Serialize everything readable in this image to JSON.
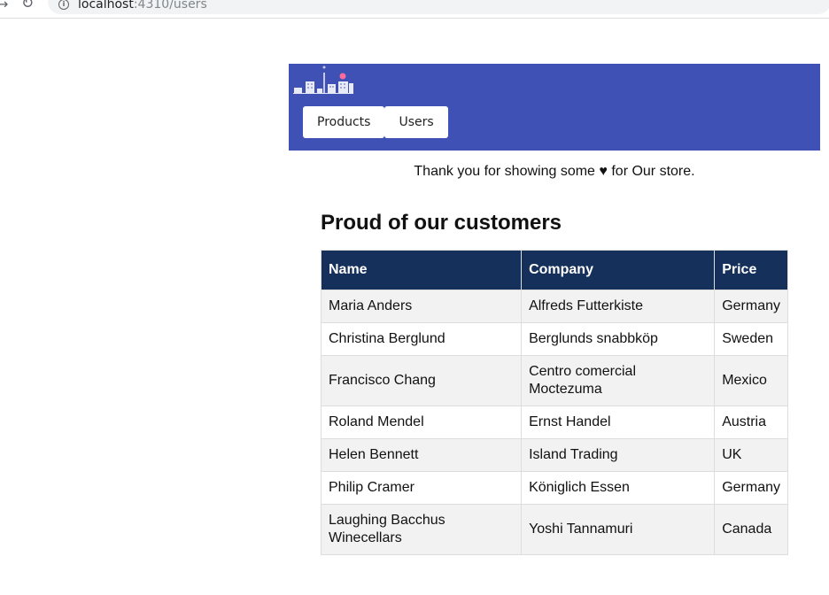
{
  "browser": {
    "url_host": "localhost",
    "url_rest": ":4310/users"
  },
  "nav": {
    "tabs": [
      {
        "label": "Products"
      },
      {
        "label": "Users"
      }
    ]
  },
  "colors": {
    "header": "#3f51b5",
    "table_header": "#15305a",
    "row_alt": "#f2f2f2"
  },
  "message": "Thank you for showing some ♥ for Our store.",
  "heading": "Proud of our customers",
  "table": {
    "headers": [
      "Name",
      "Company",
      "Price"
    ],
    "rows": [
      [
        "Maria Anders",
        "Alfreds Futterkiste",
        "Germany"
      ],
      [
        "Christina Berglund",
        "Berglunds snabbköp",
        "Sweden"
      ],
      [
        "Francisco Chang",
        "Centro comercial Moctezuma",
        "Mexico"
      ],
      [
        "Roland Mendel",
        "Ernst Handel",
        "Austria"
      ],
      [
        "Helen Bennett",
        "Island Trading",
        "UK"
      ],
      [
        "Philip Cramer",
        "Königlich Essen",
        "Germany"
      ],
      [
        "Laughing Bacchus Winecellars",
        "Yoshi Tannamuri",
        "Canada"
      ]
    ]
  }
}
